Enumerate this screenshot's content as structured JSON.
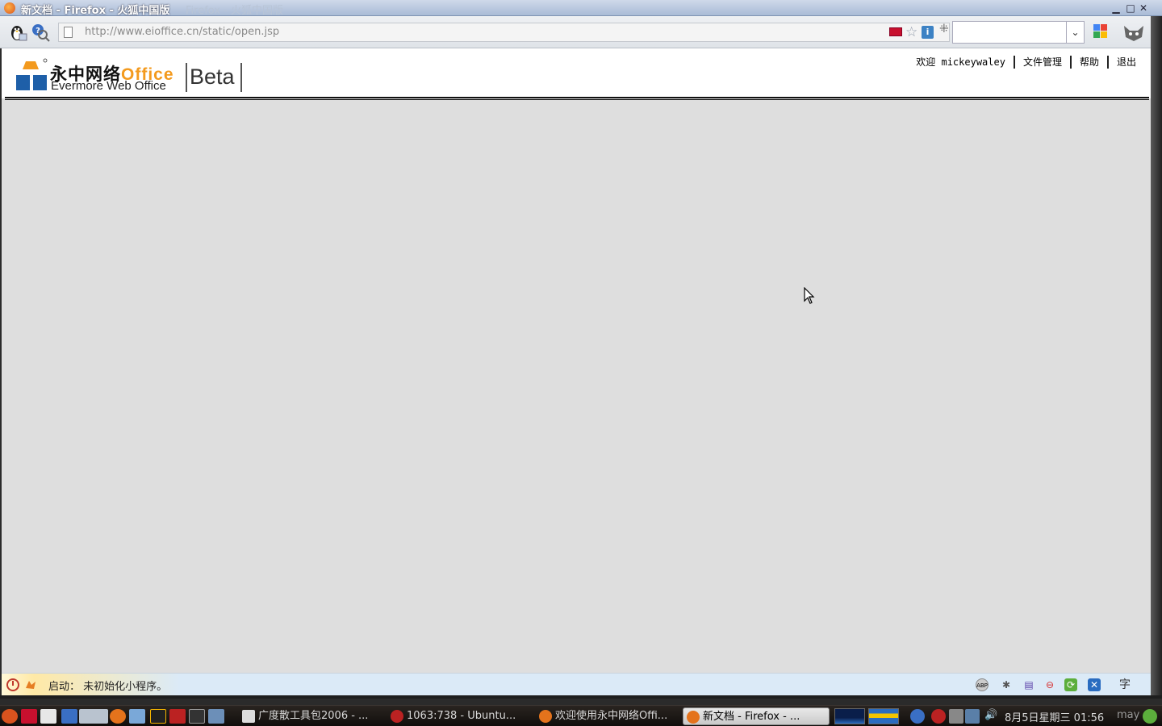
{
  "window": {
    "title": "新文档 - Firefox - 火狐中国版",
    "ghost_title": "Firefox - 火狐中国版",
    "controls": {
      "minimize": "▁",
      "maximize": "□",
      "close": "✕"
    }
  },
  "navbar": {
    "url": "http://www.eioffice.cn/static/open.jsp",
    "search_value": "",
    "icons": [
      "linux-tux-icon",
      "help-search-icon",
      "page-icon",
      "flag-icon",
      "bookmark-star-icon",
      "info-icon",
      "google-icon",
      "mascot-icon"
    ]
  },
  "page": {
    "logo": {
      "cn_name": "永中网络",
      "office": "Office",
      "en_name": "Evermore Web Office",
      "beta": "Beta"
    },
    "header_links": {
      "welcome": "欢迎 mickeywaley",
      "file_manage": "文件管理",
      "help": "帮助",
      "logout": "退出"
    },
    "background_color": "#dedede"
  },
  "statusbar": {
    "text": "启动： 未初始化小程序。",
    "tray_icons": [
      "abp-icon",
      "gear-icon",
      "film-icon",
      "stop-icon",
      "refresh-icon",
      "x-icon",
      "charset-icon"
    ],
    "charset_label": "字"
  },
  "taskbar": {
    "tasks": [
      {
        "label": "广度散工具包2006 - ..."
      },
      {
        "label": "1063:738 - Ubuntu..."
      },
      {
        "label": "欢迎使用永中网络Offi..."
      },
      {
        "label": "新文档 - Firefox - ...",
        "active": true
      }
    ],
    "clock": "8月5日星期三 01:56",
    "user": "may"
  }
}
